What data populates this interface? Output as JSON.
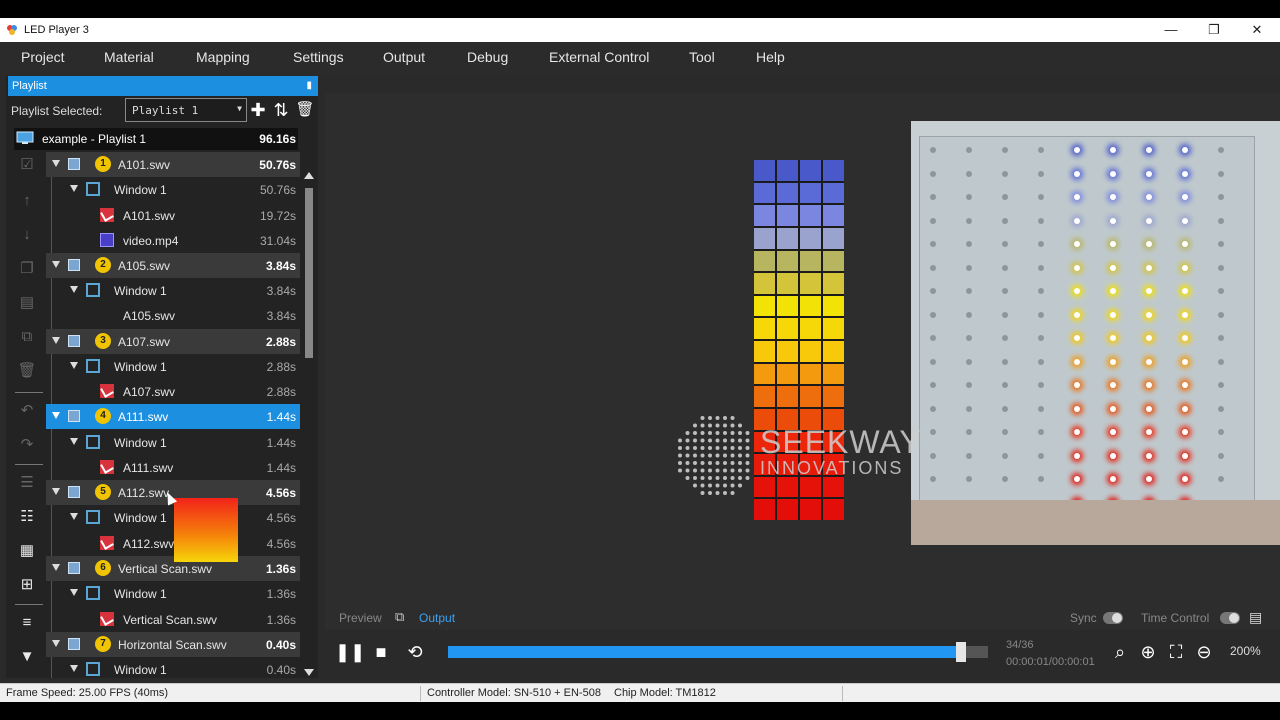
{
  "window": {
    "title": "LED Player 3",
    "minimize": "—",
    "restore": "❐",
    "close": "✕"
  },
  "menu": [
    "Project",
    "Material",
    "Mapping",
    "Settings",
    "Output",
    "Debug",
    "External Control",
    "Tool",
    "Help"
  ],
  "playlist_panel": {
    "header": "Playlist",
    "pin": "📌",
    "selected_label": "Playlist Selected:",
    "selected_value": "Playlist 1",
    "root": {
      "name": "example - Playlist 1",
      "duration": "96.16s"
    },
    "items": [
      {
        "level": 0,
        "badge": "1",
        "name": "A101.swv",
        "duration": "50.76s"
      },
      {
        "level": 1,
        "name": "Window 1",
        "duration": "50.76s"
      },
      {
        "level": 2,
        "type": "swv",
        "name": "A101.swv",
        "duration": "19.72s"
      },
      {
        "level": 2,
        "type": "video",
        "name": "video.mp4",
        "duration": "31.04s"
      },
      {
        "level": 0,
        "badge": "2",
        "name": "A105.swv",
        "duration": "3.84s"
      },
      {
        "level": 1,
        "name": "Window 1",
        "duration": "3.84s"
      },
      {
        "level": 2,
        "type": "swv",
        "name": "A105.swv",
        "duration": "3.84s"
      },
      {
        "level": 0,
        "badge": "3",
        "name": "A107.swv",
        "duration": "2.88s"
      },
      {
        "level": 1,
        "name": "Window 1",
        "duration": "2.88s"
      },
      {
        "level": 2,
        "type": "swv",
        "name": "A107.swv",
        "duration": "2.88s"
      },
      {
        "level": 0,
        "badge": "4",
        "name": "A111.swv",
        "duration": "1.44s",
        "selected": true
      },
      {
        "level": 1,
        "name": "Window 1",
        "duration": "1.44s"
      },
      {
        "level": 2,
        "type": "swv",
        "name": "A111.swv",
        "duration": "1.44s"
      },
      {
        "level": 0,
        "badge": "5",
        "name": "A112.swv",
        "duration": "4.56s"
      },
      {
        "level": 1,
        "name": "Window 1",
        "duration": "4.56s"
      },
      {
        "level": 2,
        "type": "swv",
        "name": "A112.swv",
        "duration": "4.56s"
      },
      {
        "level": 0,
        "badge": "6",
        "name": "Vertical Scan.swv",
        "duration": "1.36s"
      },
      {
        "level": 1,
        "name": "Window 1",
        "duration": "1.36s"
      },
      {
        "level": 2,
        "type": "swv",
        "name": "Vertical Scan.swv",
        "duration": "1.36s"
      },
      {
        "level": 0,
        "badge": "7",
        "name": "Horizontal Scan.swv",
        "duration": "0.40s"
      },
      {
        "level": 1,
        "name": "Window 1",
        "duration": "0.40s"
      }
    ]
  },
  "watermark": {
    "line1": "SEEKWAY",
    "line2": "INNOVATIONS"
  },
  "view_tabs": {
    "preview": "Preview",
    "output": "Output",
    "sync": "Sync",
    "time_control": "Time Control"
  },
  "transport": {
    "progress": 0.95,
    "frame": "34/36",
    "time": "00:00:01/00:00:01",
    "zoom": "200%"
  },
  "status": {
    "frame_speed": "Frame Speed: 25.00 FPS (40ms)",
    "controller": "Controller Model: SN-510 + EN-508",
    "chip": "Chip Model: TM1812"
  },
  "colors": {
    "accent": "#1c8fe0",
    "led_rows": [
      "#4a59c9",
      "#5a6ad6",
      "#7b86e0",
      "#9aa3ce",
      "#b8b560",
      "#d4c43a",
      "#f2e205",
      "#f6d809",
      "#f8c90b",
      "#f39a0e",
      "#ee6d0c",
      "#eb4c0a",
      "#eb260a",
      "#e81a0a",
      "#e5120a",
      "#e30e0a"
    ]
  }
}
